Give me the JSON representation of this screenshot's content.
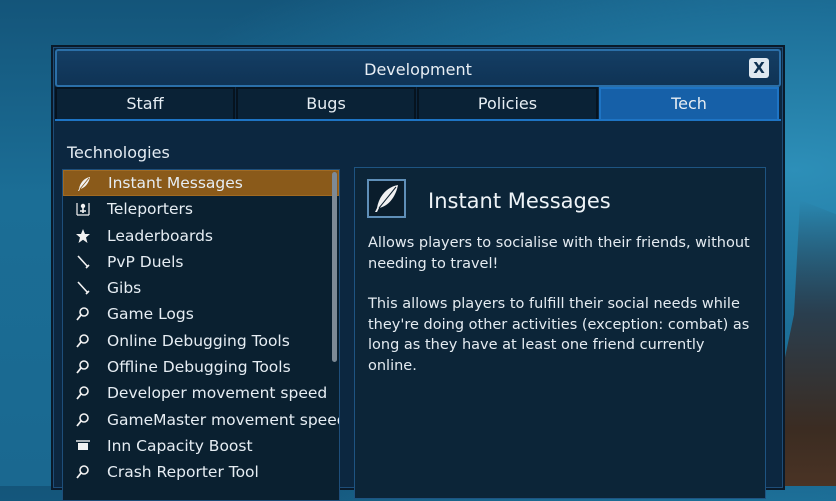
{
  "window": {
    "title": "Development",
    "close_label": "X"
  },
  "tabs": [
    {
      "label": "Staff",
      "active": false
    },
    {
      "label": "Bugs",
      "active": false
    },
    {
      "label": "Policies",
      "active": false
    },
    {
      "label": "Tech",
      "active": true
    }
  ],
  "section_label": "Technologies",
  "technologies": [
    {
      "label": "Instant Messages",
      "icon": "feather-icon",
      "selected": true
    },
    {
      "label": "Teleporters",
      "icon": "teleporter-icon"
    },
    {
      "label": "Leaderboards",
      "icon": "star-icon"
    },
    {
      "label": "PvP Duels",
      "icon": "swords-icon"
    },
    {
      "label": "Gibs",
      "icon": "swords-icon"
    },
    {
      "label": "Game Logs",
      "icon": "magnifier-icon"
    },
    {
      "label": "Online Debugging Tools",
      "icon": "magnifier-icon"
    },
    {
      "label": "Offline Debugging Tools",
      "icon": "magnifier-icon"
    },
    {
      "label": "Developer movement speed",
      "icon": "magnifier-icon"
    },
    {
      "label": "GameMaster movement speed",
      "icon": "magnifier-icon"
    },
    {
      "label": "Inn Capacity Boost",
      "icon": "sign-icon"
    },
    {
      "label": "Crash Reporter Tool",
      "icon": "magnifier-icon"
    }
  ],
  "detail": {
    "title": "Instant Messages",
    "icon": "feather-icon",
    "paragraph1": "Allows players to socialise with their friends, without needing to travel!",
    "paragraph2": "This allows players to fulfill their social needs while they're doing other activities (exception: combat) as long as they have at least one friend currently online."
  },
  "colors": {
    "selected_row": "#8a5a1a",
    "active_tab": "#1660a8",
    "panel_bg": "#0c2538"
  }
}
